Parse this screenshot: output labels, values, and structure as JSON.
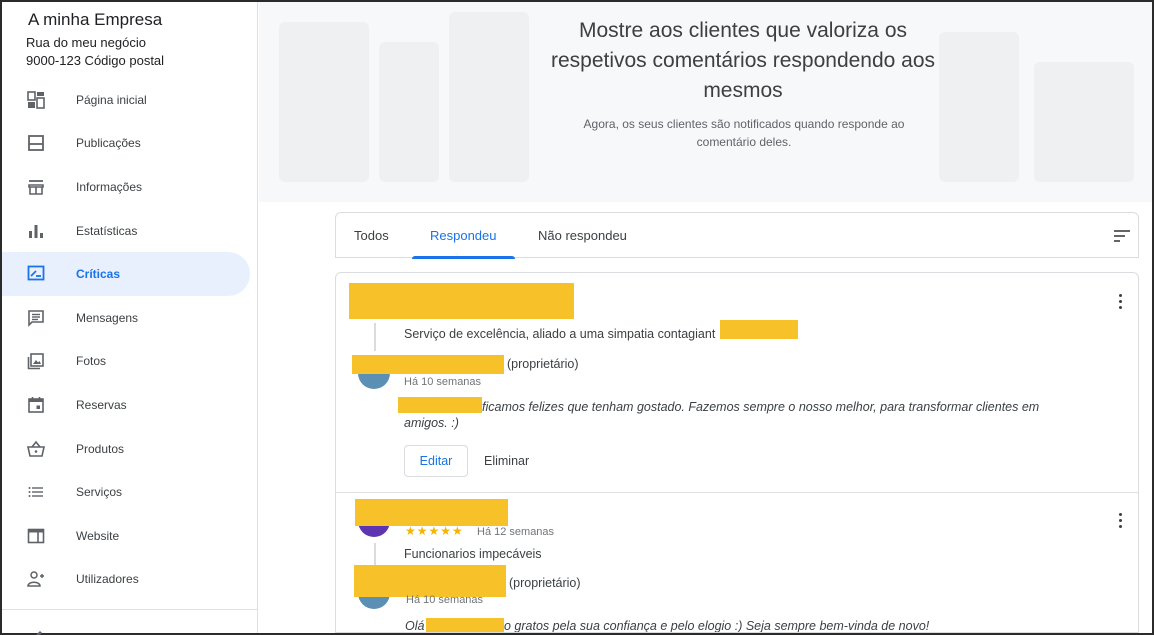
{
  "business": {
    "name": "A minha Empresa",
    "address_line1": "Rua do meu negócio",
    "address_line2": "9000-123 Código postal"
  },
  "sidebar": {
    "items": [
      {
        "label": "Página inicial",
        "icon": "dashboard-icon"
      },
      {
        "label": "Publicações",
        "icon": "posts-icon"
      },
      {
        "label": "Informações",
        "icon": "storefront-icon"
      },
      {
        "label": "Estatísticas",
        "icon": "bar-chart-icon"
      },
      {
        "label": "Críticas",
        "icon": "reviews-icon",
        "active": true
      },
      {
        "label": "Mensagens",
        "icon": "message-icon"
      },
      {
        "label": "Fotos",
        "icon": "photos-icon"
      },
      {
        "label": "Reservas",
        "icon": "calendar-icon"
      },
      {
        "label": "Produtos",
        "icon": "basket-icon"
      },
      {
        "label": "Serviços",
        "icon": "list-icon"
      },
      {
        "label": "Website",
        "icon": "web-icon"
      },
      {
        "label": "Utilizadores",
        "icon": "add-user-icon"
      }
    ]
  },
  "hero": {
    "title": "Mostre aos clientes que valoriza os respetivos comentários respondendo aos mesmos",
    "subtitle": "Agora, os seus clientes são notificados quando responde ao comentário deles."
  },
  "tabs": [
    {
      "label": "Todos"
    },
    {
      "label": "Respondeu",
      "active": true
    },
    {
      "label": "Não respondeu"
    }
  ],
  "reviews": [
    {
      "text": "Serviço de excelência, aliado a uma simpatia contagiant",
      "owner_tag": "(proprietário)",
      "reply_time": "Há 10 semanas",
      "reply_text": "ficamos felizes que tenham gostado. Fazemos sempre o nosso melhor, para transformar clientes em amigos. :)",
      "edit_label": "Editar",
      "delete_label": "Eliminar"
    },
    {
      "stars": "★★★★★",
      "rating": 5,
      "time": "Há 12 semanas",
      "text": "Funcionarios impecáveis",
      "owner_tag": "(proprietário)",
      "reply_time": "Há 10 semanas",
      "reply_prefix": "Olá",
      "reply_text": "o gratos pela sua confiança e pelo elogio :) Seja sempre bem-vinda de novo!"
    }
  ],
  "colors": {
    "accent": "#1a73e8",
    "active_bg": "#e8f0fe",
    "redaction": "#f7c12a",
    "star": "#f4b400"
  }
}
